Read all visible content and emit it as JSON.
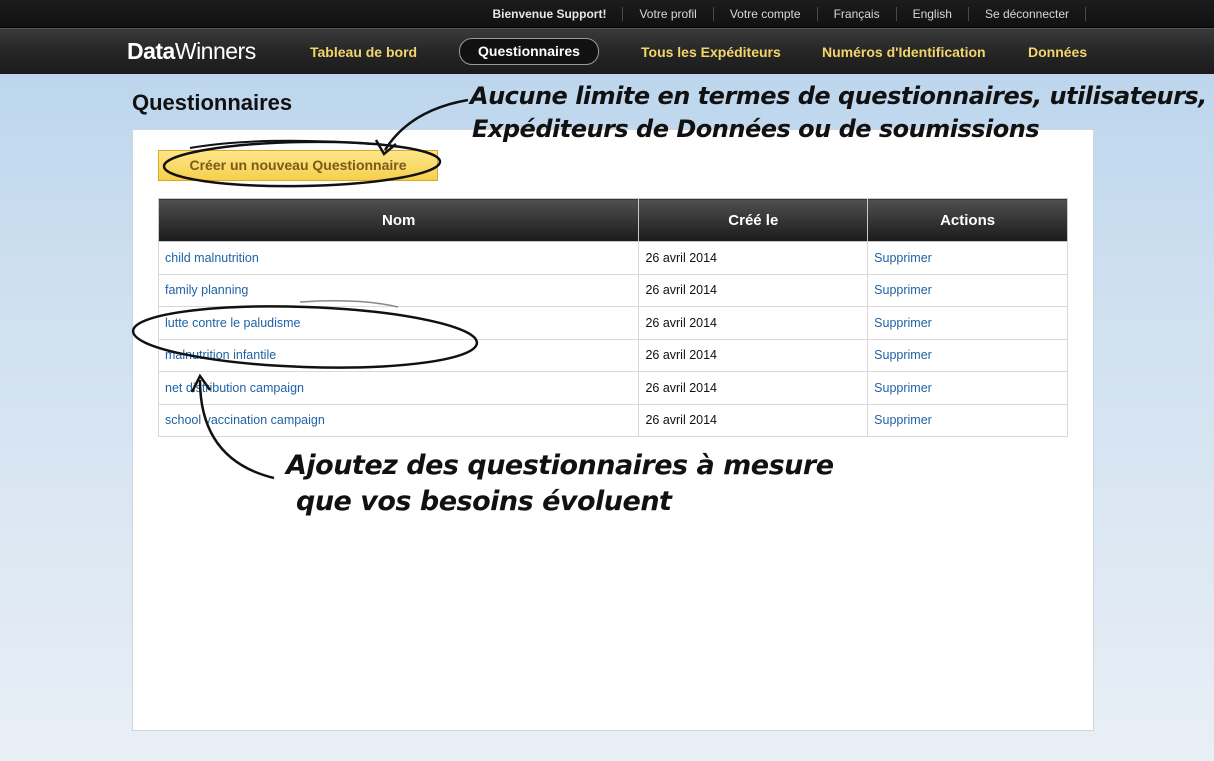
{
  "topbar": {
    "welcome": "Bienvenue Support!",
    "links": [
      "Votre profil",
      "Votre compte",
      "Français",
      "English",
      "Se déconnecter"
    ]
  },
  "nav": {
    "logo_bold": "Data",
    "logo_light": "Winners",
    "items": [
      "Tableau de bord",
      "Questionnaires",
      "Tous les Expéditeurs",
      "Numéros d'Identification",
      "Données"
    ],
    "active": "Questionnaires"
  },
  "page": {
    "title": "Questionnaires",
    "create_button": "Créer un nouveau Questionnaire"
  },
  "table": {
    "headers": [
      "Nom",
      "Créé le",
      "Actions"
    ],
    "rows": [
      {
        "name": "child malnutrition",
        "date": "26 avril 2014",
        "action": "Supprimer"
      },
      {
        "name": "family planning",
        "date": "26 avril 2014",
        "action": "Supprimer"
      },
      {
        "name": "lutte contre le paludisme",
        "date": "26 avril 2014",
        "action": "Supprimer"
      },
      {
        "name": "malnutrition infantile",
        "date": "26 avril 2014",
        "action": "Supprimer"
      },
      {
        "name": "net distribution campaign",
        "date": "26 avril 2014",
        "action": "Supprimer"
      },
      {
        "name": "school vaccination campaign",
        "date": "26 avril 2014",
        "action": "Supprimer"
      }
    ]
  },
  "annotations": {
    "top_line1": "Aucune limite en termes de questionnaires, utilisateurs,",
    "top_line2": "Expéditeurs de Données ou de soumissions",
    "bottom_line1": "Ajoutez des questionnaires à mesure",
    "bottom_line2": "que vos besoins évoluent"
  },
  "colors": {
    "nav_link": "#f3d66a",
    "link": "#1f62a6",
    "button_bg": "#f7cf4c"
  }
}
